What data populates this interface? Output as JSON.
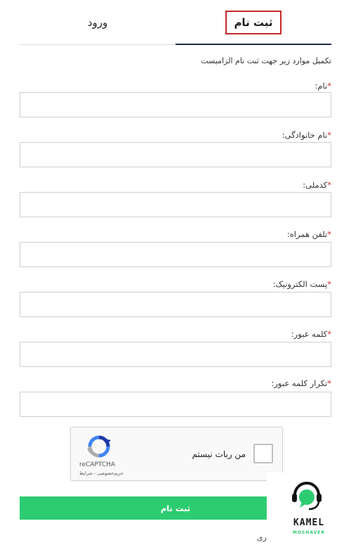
{
  "tabs": {
    "register": "ثبت نام",
    "login": "ورود"
  },
  "intro": "تکمیل موارد زیر جهت ثبت نام الزامیست",
  "fields": [
    {
      "label": "نام:",
      "value": ""
    },
    {
      "label": "نام خانوادگی:",
      "value": ""
    },
    {
      "label": "کدملی:",
      "value": ""
    },
    {
      "label": "تلفن همراه:",
      "value": ""
    },
    {
      "label": "پست الکترونیک:",
      "value": ""
    },
    {
      "label": "کلمه عبور:",
      "value": ""
    },
    {
      "label": "تکرار کلمه عبور:",
      "value": ""
    }
  ],
  "required_marker": "*",
  "captcha": {
    "checkbox_label": "من ربات نیستم",
    "brand": "reCAPTCHA",
    "terms": "حریم‌خصوصی - شرایط"
  },
  "submit_label": "ثبت نام",
  "footer_text": "ری",
  "watermark": {
    "name": "KAMEL",
    "subtitle": "MOSHAVER"
  },
  "colors": {
    "accent_green": "#2ecc71",
    "required_red": "#d32f2f",
    "tab_highlight": "#c62828",
    "tab_underline": "#1f2a44"
  }
}
